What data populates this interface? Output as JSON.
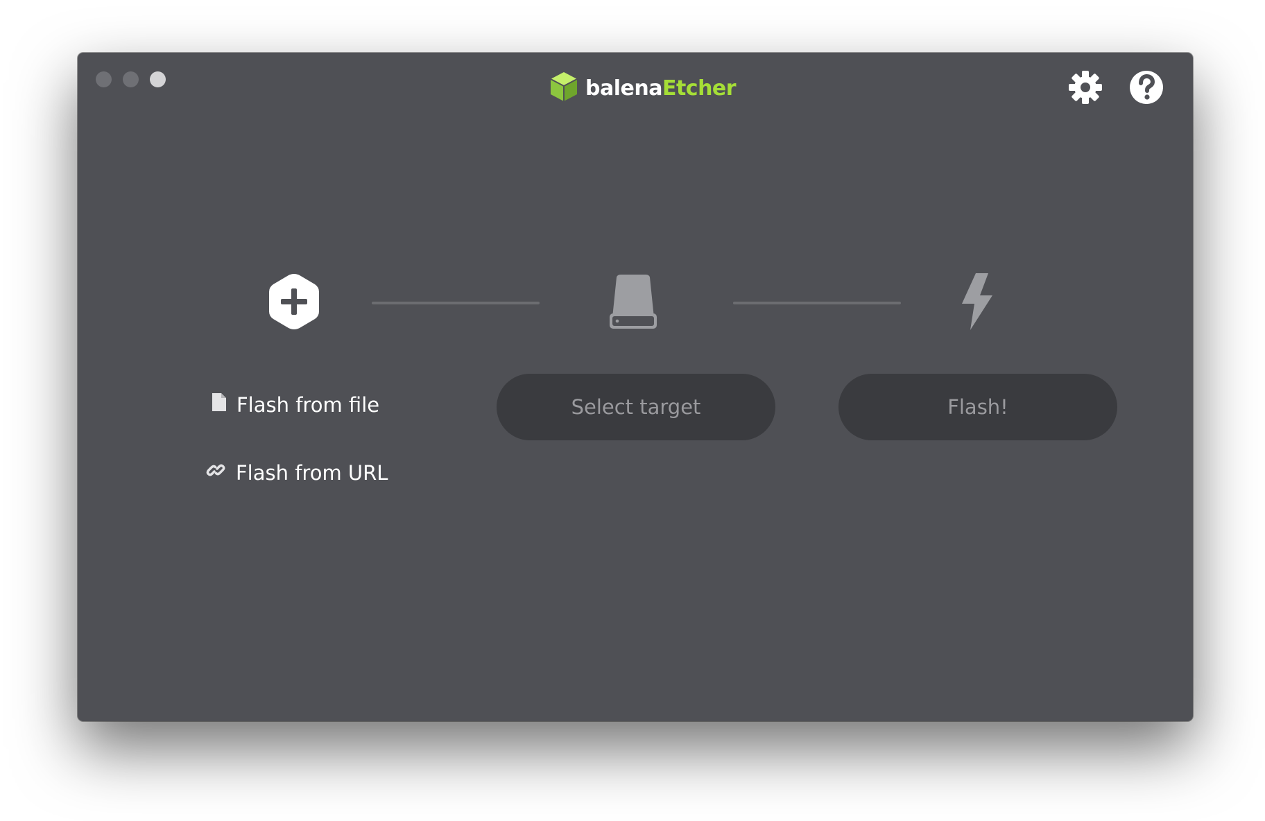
{
  "window": {
    "traffic_lights": [
      "close",
      "minimize",
      "maximize"
    ]
  },
  "header": {
    "brand_part1": "balena",
    "brand_part2": "Etcher",
    "logo_icon": "cube-icon",
    "settings_icon": "gear-icon",
    "help_icon": "question-circle-icon",
    "brand_accent_color": "#a5de37"
  },
  "steps": {
    "source": {
      "icon": "hexagon-plus-icon",
      "flash_from_file_label": "Flash from file",
      "flash_from_url_label": "Flash from URL",
      "file_icon": "file-icon",
      "link_icon": "link-icon"
    },
    "target": {
      "icon": "drive-icon",
      "button_label": "Select target"
    },
    "flash": {
      "icon": "lightning-icon",
      "button_label": "Flash!"
    }
  }
}
